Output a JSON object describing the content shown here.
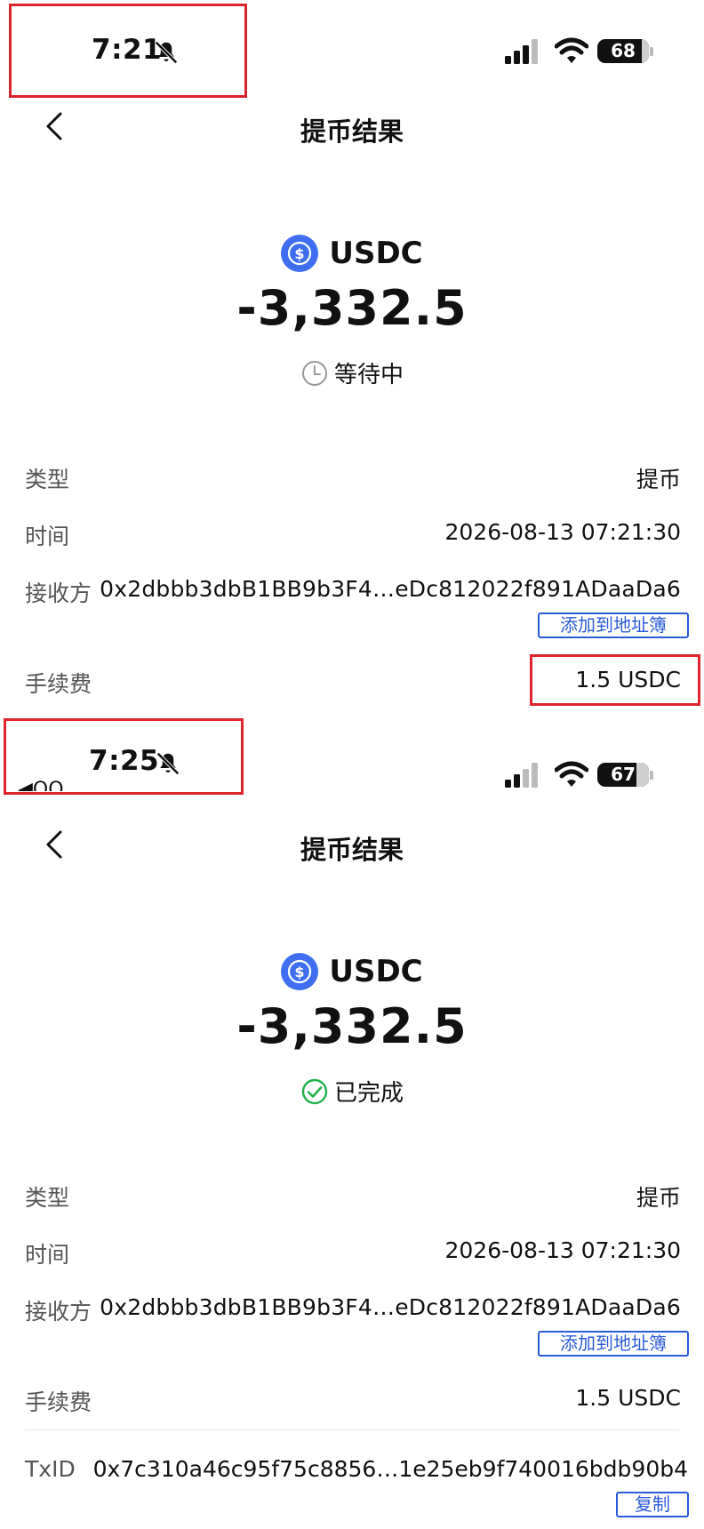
{
  "screens": [
    {
      "status_bar": {
        "time": "7:21",
        "battery": "68"
      },
      "nav": {
        "title": "提币结果"
      },
      "coin": {
        "name": "USDC",
        "amount": "-3,332.5",
        "status": "等待中"
      },
      "details": {
        "type_label": "类型",
        "type_value": "提币",
        "time_label": "时间",
        "time_value": "2026-08-13 07:21:30",
        "receiver_label": "接收方",
        "receiver_value": "0x2dbbb3dbB1BB9b3F4…eDc812022f891ADaaDa6",
        "add_address_label": "添加到地址簿",
        "fee_label": "手续费",
        "fee_value": "1.5 USDC"
      }
    },
    {
      "status_bar": {
        "time": "7:25",
        "battery": "67",
        "overflow_text": "◀QQ"
      },
      "nav": {
        "title": "提币结果"
      },
      "coin": {
        "name": "USDC",
        "amount": "-3,332.5",
        "status": "已完成"
      },
      "details": {
        "type_label": "类型",
        "type_value": "提币",
        "time_label": "时间",
        "time_value": "2026-08-13 07:21:30",
        "receiver_label": "接收方",
        "receiver_value": "0x2dbbb3dbB1BB9b3F4…eDc812022f891ADaaDa6",
        "add_address_label": "添加到地址簿",
        "fee_label": "手续费",
        "fee_value": "1.5 USDC",
        "txid_label": "TxID",
        "txid_value": "0x7c310a46c95f75c8856…1e25eb9f740016bdb90b4",
        "copy_label": "复制"
      }
    }
  ],
  "colors": {
    "accent_blue": "#2a5bd7",
    "coin_blue": "#3f6ff0",
    "success_green": "#22b04b",
    "highlight_red": "#e0242d"
  },
  "icons": [
    "back-chevron-icon",
    "bell-slash-icon",
    "cellular-signal-icon",
    "wifi-icon",
    "battery-icon",
    "usdc-coin-icon",
    "clock-icon",
    "check-circle-icon"
  ]
}
